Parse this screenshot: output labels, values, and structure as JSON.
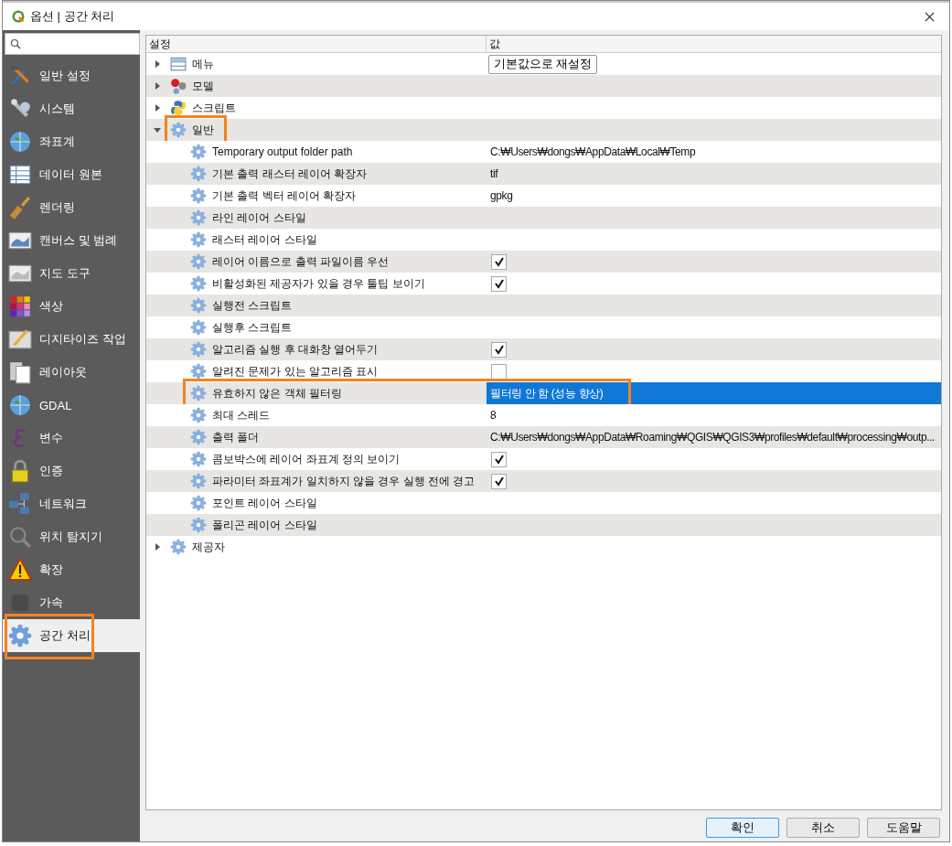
{
  "window": {
    "title": "옵션 | 공간 처리"
  },
  "sidebar": {
    "items": [
      {
        "label": "일반 설정",
        "selected": false,
        "highlighted": false
      },
      {
        "label": "시스템",
        "selected": false,
        "highlighted": false
      },
      {
        "label": "좌표계",
        "selected": false,
        "highlighted": false
      },
      {
        "label": "데이터 원본",
        "selected": false,
        "highlighted": false
      },
      {
        "label": "렌더링",
        "selected": false,
        "highlighted": false
      },
      {
        "label": "캔버스 및 범례",
        "selected": false,
        "highlighted": false
      },
      {
        "label": "지도 도구",
        "selected": false,
        "highlighted": false
      },
      {
        "label": "색상",
        "selected": false,
        "highlighted": false
      },
      {
        "label": "디지타이즈 작업",
        "selected": false,
        "highlighted": false
      },
      {
        "label": "레이아웃",
        "selected": false,
        "highlighted": false
      },
      {
        "label": "GDAL",
        "selected": false,
        "highlighted": false
      },
      {
        "label": "변수",
        "selected": false,
        "highlighted": false
      },
      {
        "label": "인증",
        "selected": false,
        "highlighted": false
      },
      {
        "label": "네트워크",
        "selected": false,
        "highlighted": false
      },
      {
        "label": "위치 탐지기",
        "selected": false,
        "highlighted": false
      },
      {
        "label": "확장",
        "selected": false,
        "highlighted": false
      },
      {
        "label": "가속",
        "selected": false,
        "highlighted": false
      },
      {
        "label": "공간 처리",
        "selected": true,
        "highlighted": true
      }
    ]
  },
  "tree": {
    "columns": [
      "설정",
      "값"
    ],
    "rows": [
      {
        "label": "메뉴",
        "expanded": false,
        "highlighted": false,
        "kind": "button",
        "value": "기본값으로 재설정"
      },
      {
        "label": "모델",
        "expanded": false,
        "highlighted": false,
        "kind": "none"
      },
      {
        "label": "스크립트",
        "expanded": false,
        "highlighted": false,
        "kind": "none"
      },
      {
        "label": "일반",
        "expanded": true,
        "highlighted": true,
        "kind": "none",
        "children": [
          {
            "label": "Temporary output folder path",
            "kind": "text",
            "value": "C:₩Users₩dongs₩AppData₩Local₩Temp",
            "selected": false,
            "highlighted": false
          },
          {
            "label": "기본 출력 래스터 레이어 확장자",
            "kind": "text",
            "value": "tif",
            "selected": false,
            "highlighted": false
          },
          {
            "label": "기본 출력 벡터 레이어 확장자",
            "kind": "text",
            "value": "gpkg",
            "selected": false,
            "highlighted": false
          },
          {
            "label": "라인 레이어 스타일",
            "kind": "none",
            "selected": false,
            "highlighted": false
          },
          {
            "label": "래스터 레이어 스타일",
            "kind": "none",
            "selected": false,
            "highlighted": false
          },
          {
            "label": "레이어 이름으로 출력 파일이름 우선",
            "kind": "checkbox",
            "checked": true,
            "selected": false,
            "highlighted": false
          },
          {
            "label": "비활성화된 제공자가 있을 경우 툴팁 보이기",
            "kind": "checkbox",
            "checked": true,
            "selected": false,
            "highlighted": false
          },
          {
            "label": "실행전 스크립트",
            "kind": "none",
            "selected": false,
            "highlighted": false
          },
          {
            "label": "실행후 스크립트",
            "kind": "none",
            "selected": false,
            "highlighted": false
          },
          {
            "label": "알고리즘 실행 후 대화창 열어두기",
            "kind": "checkbox",
            "checked": true,
            "selected": false,
            "highlighted": false
          },
          {
            "label": "알려진 문제가 있는 알고리즘 표시",
            "kind": "checkbox",
            "checked": false,
            "selected": false,
            "highlighted": false
          },
          {
            "label": "유효하지 않은 객체 필터링",
            "kind": "text",
            "value": "필터링 안 함 (성능 향상)",
            "selected": true,
            "highlighted": true
          },
          {
            "label": "최대 스레드",
            "kind": "text",
            "value": "8",
            "selected": false,
            "highlighted": false
          },
          {
            "label": "출력 폴더",
            "kind": "text",
            "value": "C:₩Users₩dongs₩AppData₩Roaming₩QGIS₩QGIS3₩profiles₩default₩processing₩outp...",
            "selected": false,
            "highlighted": false
          },
          {
            "label": "콤보박스에 레이어 좌표계 정의 보이기",
            "kind": "checkbox",
            "checked": true,
            "selected": false,
            "highlighted": false
          },
          {
            "label": "파라미터 좌표계가 일치하지 않을 경우 실행 전에 경고",
            "kind": "checkbox",
            "checked": true,
            "selected": false,
            "highlighted": false
          },
          {
            "label": "포인트 레이어 스타일",
            "kind": "none",
            "selected": false,
            "highlighted": false
          },
          {
            "label": "폴리곤 레이어 스타일",
            "kind": "none",
            "selected": false,
            "highlighted": false
          }
        ]
      },
      {
        "label": "제공자",
        "expanded": false,
        "highlighted": false,
        "kind": "none"
      }
    ]
  },
  "buttons": [
    {
      "label": "확인",
      "default": true
    },
    {
      "label": "취소",
      "default": false
    },
    {
      "label": "도움말",
      "default": false
    }
  ]
}
